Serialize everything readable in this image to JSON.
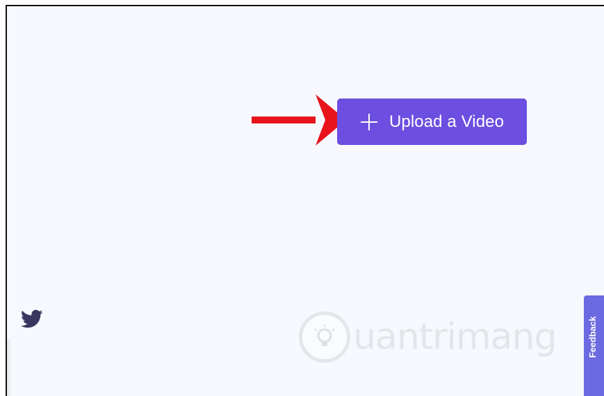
{
  "main": {
    "upload_button": {
      "label": "Upload a Video",
      "icon": "plus-icon"
    }
  },
  "annotation": {
    "arrow_color": "#e8141c",
    "icon": "arrow-right-icon"
  },
  "social": {
    "twitter_icon": "twitter-icon"
  },
  "watermark": {
    "text": "uantrimang",
    "icon": "lightbulb-icon"
  },
  "feedback_tab": {
    "label": "Feedback"
  },
  "colors": {
    "background": "#f7f9fe",
    "button": "#6c4fe0",
    "feedback_tab": "#6c6ae0",
    "twitter_icon": "#3b3660"
  }
}
